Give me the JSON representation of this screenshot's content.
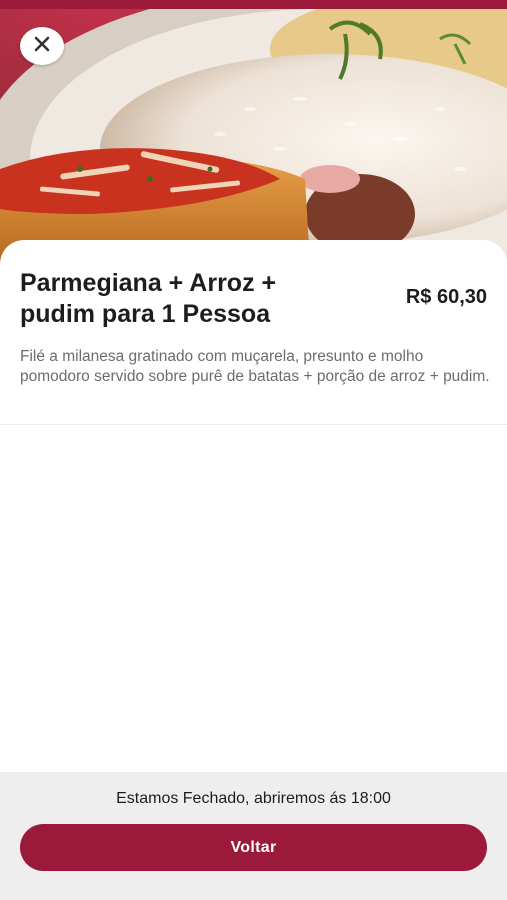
{
  "colors": {
    "brand": "#9b1a3c",
    "title_text": "#1d1d1d",
    "description_text": "#6c6c6c",
    "footer_background": "#eeeeee"
  },
  "header": {
    "close_icon": "close-icon"
  },
  "product": {
    "title": "Parmegiana + Arroz + pudim para 1 Pessoa",
    "price": "R$ 60,30",
    "description": "Filé a milanesa gratinado com muçarela, presunto e molho pomodoro servido sobre purê de batatas + porção de arroz + pudim."
  },
  "footer": {
    "status": "Estamos Fechado, abriremos ás 18:00",
    "back_label": "Voltar"
  }
}
